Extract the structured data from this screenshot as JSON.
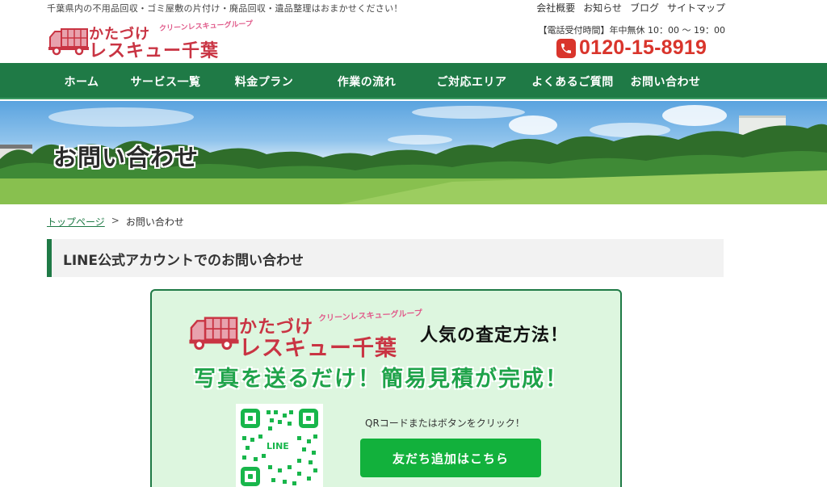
{
  "header": {
    "tagline": "千葉県内の不用品回収・ゴミ屋敷の片付け・廃品回収・遺品整理はおまかせください！",
    "top_links": [
      "会社概要",
      "お知らせ",
      "ブログ",
      "サイトマップ"
    ],
    "hours": "【電話受付時間】年中無休 10：00 ～ 19：00",
    "phone": "0120-15-8919",
    "logo": {
      "line1": "かたづけ",
      "line2": "レスキュー千葉",
      "sub": "クリーンレスキューグループ"
    }
  },
  "nav": {
    "items": [
      "ホーム",
      "サービス一覧",
      "料金プラン",
      "作業の流れ",
      "ご対応エリア",
      "よくあるご質問",
      "お問い合わせ"
    ]
  },
  "hero": {
    "title": "お問い合わせ"
  },
  "breadcrumb": {
    "home": "トップページ",
    "separator": ">",
    "current": "お問い合わせ"
  },
  "section": {
    "heading": "LINE公式アカウントでのお問い合わせ"
  },
  "line_card": {
    "logo_line1": "かたづけ",
    "logo_line2": "レスキュー千葉",
    "logo_sub": "クリーンレスキューグループ",
    "popular": "人気の査定方法！",
    "catch": "写真を送るだけ！簡易見積が完成！",
    "qr_label": "LINE",
    "qr_note": "QRコードまたはボタンをクリック！",
    "button_label": "友だち追加はこちら"
  },
  "colors": {
    "nav_green": "#1f7a46",
    "brand_red": "#c93443",
    "phone_red": "#d9352c",
    "line_green": "#12b13c",
    "card_bg": "#ddf6df"
  }
}
